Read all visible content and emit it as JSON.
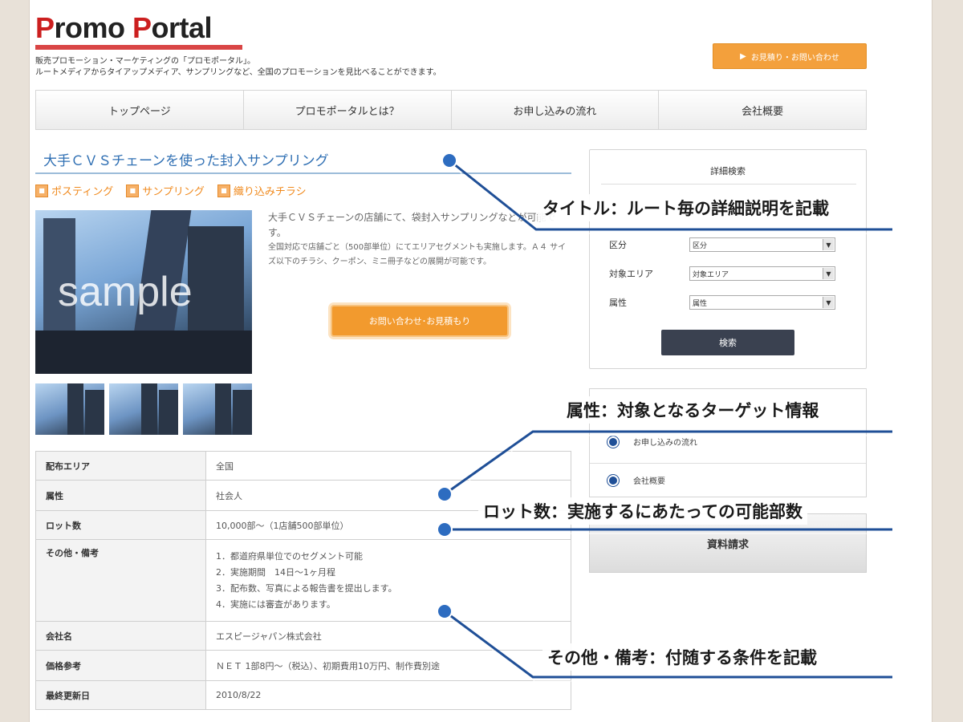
{
  "header": {
    "logo_text_part1": "P",
    "logo_text_part2": "romo ",
    "logo_text_part3": "P",
    "logo_text_part4": "ortal",
    "tagline_line1": "販売プロモーション・マーケティングの「プロモポータル」。",
    "tagline_line2": "ルートメディアからタイアップメディア、サンプリングなど、全国のプロモーションを見比べることができます。",
    "cta_label": "お見積り・お問い合わせ"
  },
  "nav": {
    "items": [
      {
        "label": "トップページ"
      },
      {
        "label": "プロモポータルとは？"
      },
      {
        "label": "お申し込みの流れ"
      },
      {
        "label": "会社概要"
      }
    ]
  },
  "main": {
    "title": "大手ＣＶＳチェーンを使った封入サンプリング",
    "tags": [
      {
        "label": "ポスティング"
      },
      {
        "label": "サンプリング"
      },
      {
        "label": "織り込みチラシ"
      }
    ],
    "photo_watermark": "sample",
    "description_lead": "大手ＣＶＳチェーンの店舗にて、袋封入サンプリングなどが可能です。",
    "description_body": "全国対応で店舗ごと（500部単位）にてエリアセグメントも実施します。Ａ４ サイズ以下のチラシ、クーポン、ミニ冊子などの展開が可能です。",
    "cta_label": "お問い合わせ･お見積もり"
  },
  "table": {
    "rows": [
      {
        "key": "配布エリア",
        "value": "全国"
      },
      {
        "key": "属性",
        "value": "社会人"
      },
      {
        "key": "ロット数",
        "value": "10,000部〜（1店舗500部単位）"
      },
      {
        "key": "その他・備考",
        "lines": [
          "1．都道府県単位でのセグメント可能",
          "2．実施期間　14日〜1ヶ月程",
          "3．配布数、写真による報告書を提出します。",
          "4．実施には審査があります。"
        ]
      },
      {
        "key": "会社名",
        "value": "エスピージャパン株式会社"
      },
      {
        "key": "価格参考",
        "value": "ＮＥＴ 1部8円〜（税込）、初期費用10万円、制作費別途"
      },
      {
        "key": "最終更新日",
        "value": "2010/8/22"
      }
    ]
  },
  "sidebar": {
    "search_title": "詳細検索",
    "fields": [
      {
        "label": "区分",
        "value": "区分"
      },
      {
        "label": "対象エリア",
        "value": "対象エリア"
      },
      {
        "label": "属性",
        "value": "属性"
      }
    ],
    "search_button": "検索",
    "links": [
      {
        "label": "お申し込みの流れ"
      },
      {
        "label": "会社概要"
      }
    ],
    "doc_button": "資料請求"
  },
  "callouts": {
    "title": "タイトル：ルート毎の詳細説明を記載",
    "attribute": "属性：対象となるターゲット情報",
    "lot": "ロット数：実施するにあたっての可能部数",
    "remarks": "その他・備考：付随する条件を記載"
  },
  "colors": {
    "accent_orange": "#f29a2e",
    "title_blue": "#2f6fb3",
    "callout_line_blue": "#1f4f97"
  }
}
